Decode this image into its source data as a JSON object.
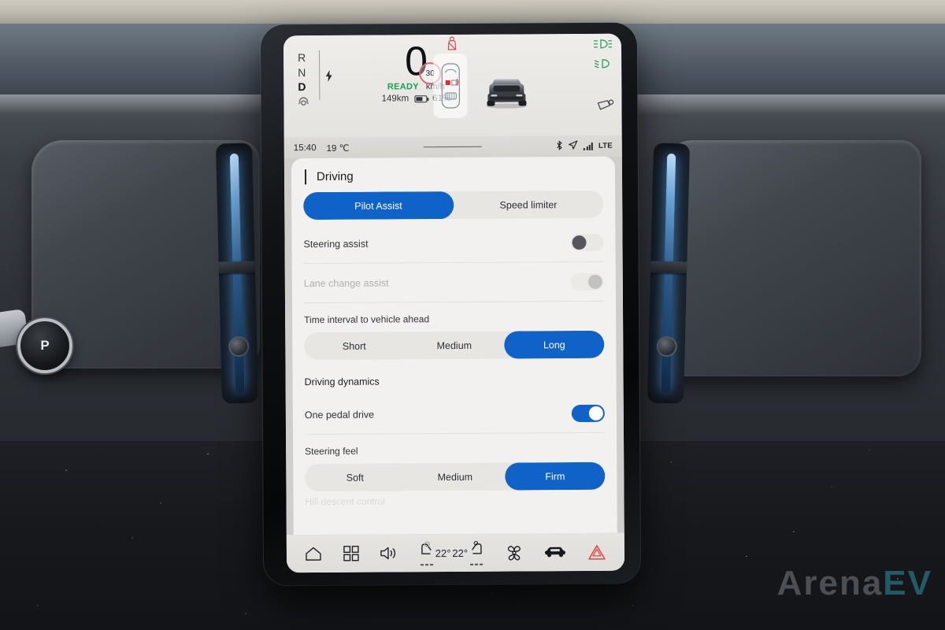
{
  "accent_color": "#0f63c8",
  "cluster": {
    "gears": [
      {
        "label": "R",
        "active": false
      },
      {
        "label": "N",
        "active": false
      },
      {
        "label": "D",
        "active": true
      }
    ],
    "regen_icon": "auto-hold-icon",
    "charge_bolt_icon": "lightning-bolt-icon",
    "speed": "0",
    "ready_label": "READY",
    "speed_unit": "km/h",
    "range": "149km",
    "battery_icon": "battery-icon",
    "battery_percent": "61%",
    "speed_limit_sign": "30",
    "seatbelt_warning_icon": "seatbelt-warning-icon",
    "occupancy_icon": "seat-occupancy-icon",
    "car_render_icon": "car-3d-render-icon",
    "indicators": [
      {
        "name": "auto-high-beam-icon",
        "color": "#2f9e5c"
      },
      {
        "name": "low-beam-icon",
        "color": "#2f9e5c"
      }
    ],
    "mirror_icon": "folded-mirror-icon"
  },
  "statusbar": {
    "time": "15:40",
    "temperature": "19 ℃",
    "bluetooth_icon": "bluetooth-icon",
    "navigation_icon": "navigation-arrow-icon",
    "signal_icon": "signal-bars-icon",
    "network": "LTE"
  },
  "settings": {
    "title": "Driving",
    "back_icon": "back-chevron-icon",
    "tabs": [
      {
        "label": "Pilot Assist",
        "selected": true
      },
      {
        "label": "Speed limiter",
        "selected": false
      }
    ],
    "rows": [
      {
        "label": "Steering assist",
        "state": "off",
        "disabled": false
      },
      {
        "label": "Lane change assist",
        "state": "muted",
        "disabled": true
      }
    ],
    "time_interval": {
      "label": "Time interval to vehicle ahead",
      "options": [
        {
          "label": "Short",
          "selected": false
        },
        {
          "label": "Medium",
          "selected": false
        },
        {
          "label": "Long",
          "selected": true
        }
      ]
    },
    "dynamics": {
      "heading": "Driving dynamics",
      "one_pedal": {
        "label": "One pedal drive",
        "state": "on"
      },
      "steering_feel": {
        "label": "Steering feel",
        "options": [
          {
            "label": "Soft",
            "selected": false
          },
          {
            "label": "Medium",
            "selected": false
          },
          {
            "label": "Firm",
            "selected": true
          }
        ]
      },
      "next_row_partial": "Hill descent control"
    }
  },
  "toolbar": {
    "items": [
      {
        "name": "home-icon"
      },
      {
        "name": "apps-grid-icon"
      },
      {
        "name": "volume-icon"
      },
      {
        "name": "seat-heat-left-icon"
      },
      {
        "name": "fan-icon"
      },
      {
        "name": "car-icon"
      },
      {
        "name": "hazard-lights-icon"
      }
    ],
    "temp_left": "22°",
    "temp_right": "22°"
  },
  "interior": {
    "park_button_label": "P"
  },
  "watermark": {
    "text_main": "Arena",
    "text_accent": "EV"
  }
}
